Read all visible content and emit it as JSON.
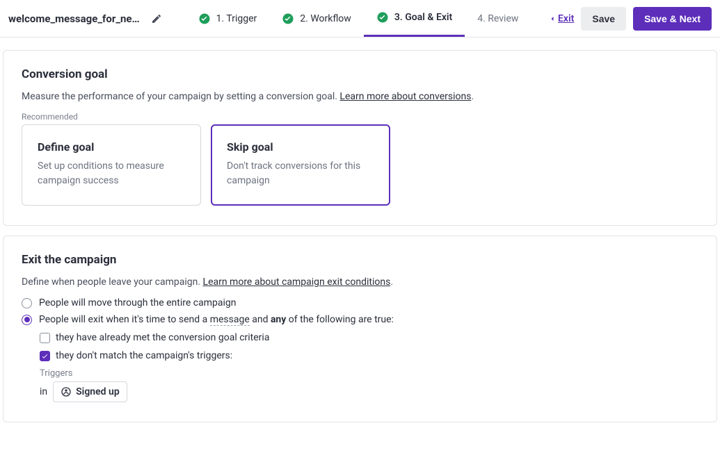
{
  "header": {
    "title": "welcome_message_for_new_…",
    "steps": [
      {
        "label": "1. Trigger",
        "done": true,
        "active": false
      },
      {
        "label": "2. Workflow",
        "done": true,
        "active": false
      },
      {
        "label": "3. Goal & Exit",
        "done": true,
        "active": true
      },
      {
        "label": "4. Review",
        "done": false,
        "active": false
      }
    ],
    "exit": "Exit",
    "save": "Save",
    "save_next": "Save & Next"
  },
  "conversion": {
    "heading": "Conversion goal",
    "desc_pre": "Measure the performance of your campaign by setting a conversion goal. ",
    "learn_more": "Learn more about conversions",
    "desc_post": ".",
    "recommended": "Recommended",
    "options": [
      {
        "title": "Define goal",
        "desc": "Set up conditions to measure campaign success",
        "selected": false
      },
      {
        "title": "Skip goal",
        "desc": "Don't track conversions for this campaign",
        "selected": true
      }
    ]
  },
  "exit_card": {
    "heading": "Exit the campaign",
    "desc_pre": "Define when people leave your campaign. ",
    "learn_more": "Learn more about campaign exit conditions",
    "desc_post": ".",
    "radio_entire": "People will move through the entire campaign",
    "radio_cond_pre": "People will exit when it's time to send a ",
    "radio_cond_msg": "message",
    "radio_cond_mid": " and ",
    "radio_cond_any": "any",
    "radio_cond_post": " of the following are true:",
    "selected_radio": 1,
    "cb_conv_met": "they have already met the conversion goal criteria",
    "cb_conv_met_checked": false,
    "cb_no_match": "they don't match the campaign's triggers:",
    "cb_no_match_checked": true,
    "triggers_label": "Triggers",
    "trigger_in": "in",
    "trigger_chip": "Signed up"
  }
}
